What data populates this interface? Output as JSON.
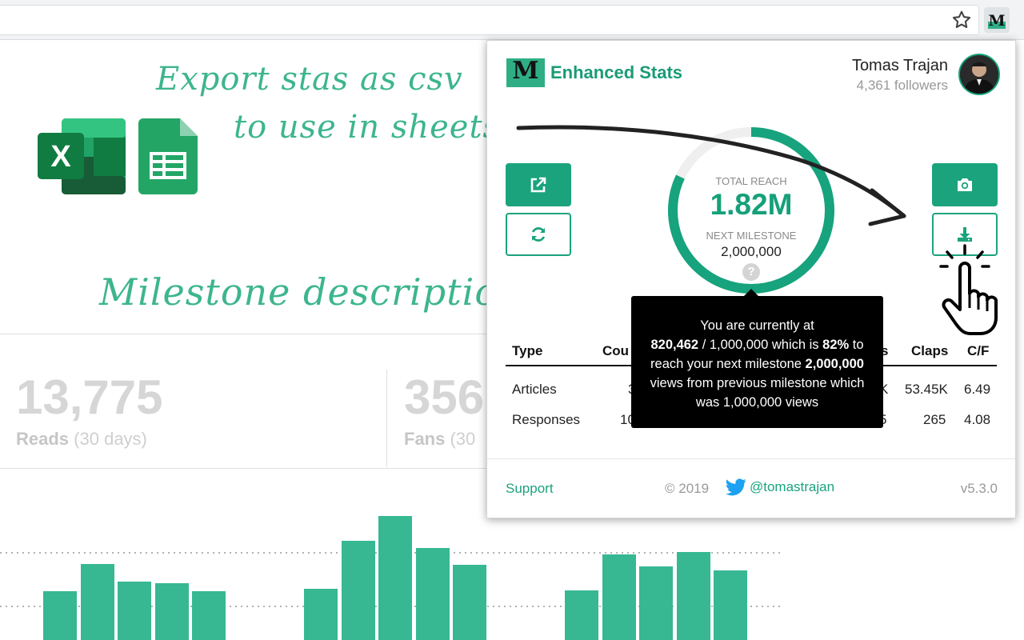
{
  "annotations": {
    "export_line1": "Export stas as csv",
    "export_line2": "to use in sheets",
    "tooltip_caption": "Milestone description tooltip"
  },
  "background_stats": {
    "reads": {
      "value": "13,775",
      "label": "Reads",
      "period": "(30 days)"
    },
    "fans": {
      "value": "356",
      "label": "Fans",
      "period": "(30"
    }
  },
  "popup": {
    "brand": {
      "logo_letter": "M",
      "name": "Enhanced Stats"
    },
    "user": {
      "name": "Tomas Trajan",
      "followers": "4,361 followers"
    },
    "gauge": {
      "title": "TOTAL REACH",
      "value": "1.82M",
      "milestone_label": "NEXT MILESTONE",
      "milestone_value": "2,000,000",
      "progress": 0.82,
      "help": "?"
    },
    "tooltip": {
      "line1": "You are currently at",
      "current": "820,462",
      "mid": " / 1,000,000 which is ",
      "percent": "82%",
      "tail": " to",
      "line3_pre": "reach your next milestone ",
      "next": "2,000,000",
      "line4": "views from previous milestone which",
      "line5": "was 1,000,000 views"
    },
    "table": {
      "headers": {
        "type": "Type",
        "count": "Cou",
        "s": "s",
        "claps": "Claps",
        "cf": "C/F"
      },
      "rows": [
        {
          "type": "Articles",
          "count": "3",
          "s": "K",
          "claps": "53.45K",
          "cf": "6.49"
        },
        {
          "type": "Responses",
          "count": "10",
          "s": "5",
          "claps": "265",
          "cf": "4.08"
        }
      ]
    },
    "footer": {
      "support": "Support",
      "copyright": "© 2019",
      "twitter": "@tomastrajan",
      "version": "v5.3.0"
    }
  },
  "colors": {
    "accent": "#1ba37d",
    "accent_light": "#37b893",
    "tooltip_bg": "#000000"
  },
  "icons": [
    "star-icon",
    "extension-icon",
    "external-link-icon",
    "refresh-icon",
    "camera-icon",
    "download-icon",
    "twitter-icon",
    "hand-pointer-icon",
    "excel-icon",
    "sheets-icon"
  ]
}
